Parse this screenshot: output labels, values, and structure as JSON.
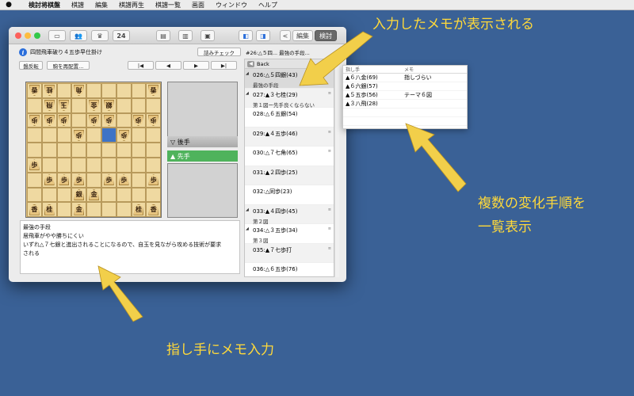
{
  "menubar": {
    "apple": "",
    "items": [
      "検討将棋盤",
      "棋譜",
      "編集",
      "棋譜再生",
      "棋譜一覧",
      "画面",
      "ウィンドウ",
      "ヘルプ"
    ]
  },
  "toolbar": {
    "move_number": "24",
    "edit_label": "編集",
    "study_label": "検討",
    "back_chevron": "<"
  },
  "game": {
    "title": "四間飛車破り４五歩早仕掛け",
    "tsumi_check": "詰みチェック",
    "position_label": "#26:△５四... 最強の手段...",
    "flip_button": "盤反転",
    "replay_button": "駒を再配置..."
  },
  "nav": [
    "|◀",
    "◀",
    "▶",
    "▶|"
  ],
  "board": {
    "rows": [
      [
        "香",
        "桂",
        "",
        "角",
        "",
        "",
        "",
        "",
        "香"
      ],
      [
        "",
        "飛",
        "玉",
        "",
        "金",
        "銀",
        "",
        "",
        ""
      ],
      [
        "歩",
        "歩",
        "歩",
        "",
        "歩",
        "歩",
        "",
        "歩",
        "歩"
      ],
      [
        "",
        "",
        "",
        "歩",
        "",
        "",
        "歩",
        "",
        ""
      ],
      [
        "",
        "",
        "",
        "",
        "",
        "",
        "",
        "",
        ""
      ],
      [
        "歩",
        "",
        "",
        "",
        "",
        "",
        "",
        "",
        ""
      ],
      [
        "",
        "歩",
        "歩",
        "歩",
        "",
        "歩",
        "歩",
        "",
        "歩"
      ],
      [
        "",
        "",
        "",
        "銀",
        "金",
        "",
        "",
        "",
        ""
      ],
      [
        "香",
        "桂",
        "",
        "金",
        "",
        "",
        "",
        "桂",
        "香"
      ]
    ],
    "gote_rows": [
      0,
      1,
      2,
      3
    ],
    "highlight": [
      3,
      5
    ]
  },
  "stand": {
    "gote_label": "▽ 後手",
    "sente_label": "▲ 先手"
  },
  "memo_text": {
    "line1": "最強の手段",
    "line2": "居飛車がやや勝ちにくい",
    "line3": "いずれ△７七銀と進出されることになるので、自玉を見ながら攻める技術が要求",
    "line4": "される"
  },
  "moves": {
    "back_label": "Back",
    "items": [
      {
        "label": "026:△５四銀(43)",
        "comment": "最強の手段",
        "marker": "◢",
        "note": ""
      },
      {
        "label": "027:▲３七桂(29)",
        "comment": "第１図ー先手良くならない",
        "marker": "◢",
        "note": "≡"
      },
      {
        "label": "028:△６五銀(54)",
        "comment": "",
        "marker": "",
        "note": ""
      },
      {
        "label": "029:▲４五歩(46)",
        "comment": "",
        "marker": "",
        "note": "≡"
      },
      {
        "label": "030:△７七角(65)",
        "comment": "",
        "marker": "",
        "note": "≡"
      },
      {
        "label": "031:▲２四歩(25)",
        "comment": "",
        "marker": "",
        "note": ""
      },
      {
        "label": "032:△同歩(23)",
        "comment": "",
        "marker": "",
        "note": ""
      },
      {
        "label": "033:▲４四歩(45)",
        "comment": "第２図",
        "marker": "◢",
        "note": "≡"
      },
      {
        "label": "034:△３五歩(34)",
        "comment": "第３図",
        "marker": "◢",
        "note": "≡"
      },
      {
        "label": "035:▲７七歩打",
        "comment": "",
        "marker": "",
        "note": "≡"
      },
      {
        "label": "036:△６五歩(76)",
        "comment": "",
        "marker": "",
        "note": ""
      }
    ]
  },
  "variations": {
    "col_move": "指し手",
    "col_memo": "メモ",
    "rows": [
      {
        "move": "▲６八金(69)",
        "memo": "指しづらい"
      },
      {
        "move": "▲６六銀(57)",
        "memo": ""
      },
      {
        "move": "▲５五歩(56)",
        "memo": "テーマ６図"
      },
      {
        "move": "▲３八飛(28)",
        "memo": ""
      }
    ]
  },
  "annotations": {
    "top": "入力したメモが表示される",
    "right1": "複数の変化手順を",
    "right2": "一覧表示",
    "bottom": "指し手にメモ入力"
  },
  "colors": {
    "desktop": "#3a6196",
    "annotation": "#ffd93a",
    "arrow": "#f2cf4a",
    "sente_green": "#4fb35c",
    "highlight": "#3e73c6"
  }
}
